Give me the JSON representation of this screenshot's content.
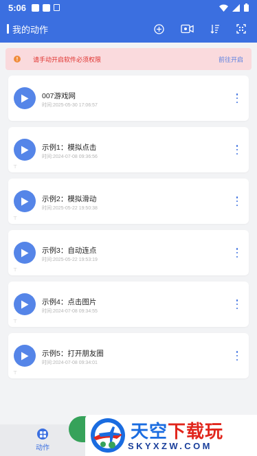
{
  "status_bar": {
    "time": "5:06"
  },
  "app_bar": {
    "title": "我的动作",
    "icons": [
      "add-circle-icon",
      "record-video-icon",
      "sort-icon",
      "scan-icon"
    ]
  },
  "warning": {
    "icon": "alert-icon",
    "color": "#f08c3a",
    "text": "请手动开启软件必须权限",
    "link": "前往开启"
  },
  "actions": [
    {
      "title": "007游戏网",
      "time": "时间:2025-05-30 17:06:57",
      "pinned": false
    },
    {
      "title": "示例1：模拟点击",
      "time": "时间:2024-07-08 09:36:56",
      "pinned": true
    },
    {
      "title": "示例2：模拟滑动",
      "time": "时间:2025-05-22 19:50:38",
      "pinned": true
    },
    {
      "title": "示例3：自动连点",
      "time": "时间:2025-05-22 19:53:19",
      "pinned": true
    },
    {
      "title": "示例4：点击图片",
      "time": "时间:2024-07-08 09:34:55",
      "pinned": true
    },
    {
      "title": "示例5：打开朋友圈",
      "time": "时间:2024-07-08 09:34:01",
      "pinned": true
    }
  ],
  "pin_symbol": "⊤",
  "bottom_nav": {
    "tab_label": "动作",
    "tab_icon": "grid-icon"
  },
  "watermark": {
    "main_blue": "天空",
    "main_red": "下载玩",
    "url": "SKYXZW.COM"
  },
  "colors": {
    "primary": "#3b6fe0",
    "play": "#5585e8",
    "warning_bg": "#fadadd",
    "warning_text": "#e0332f"
  }
}
